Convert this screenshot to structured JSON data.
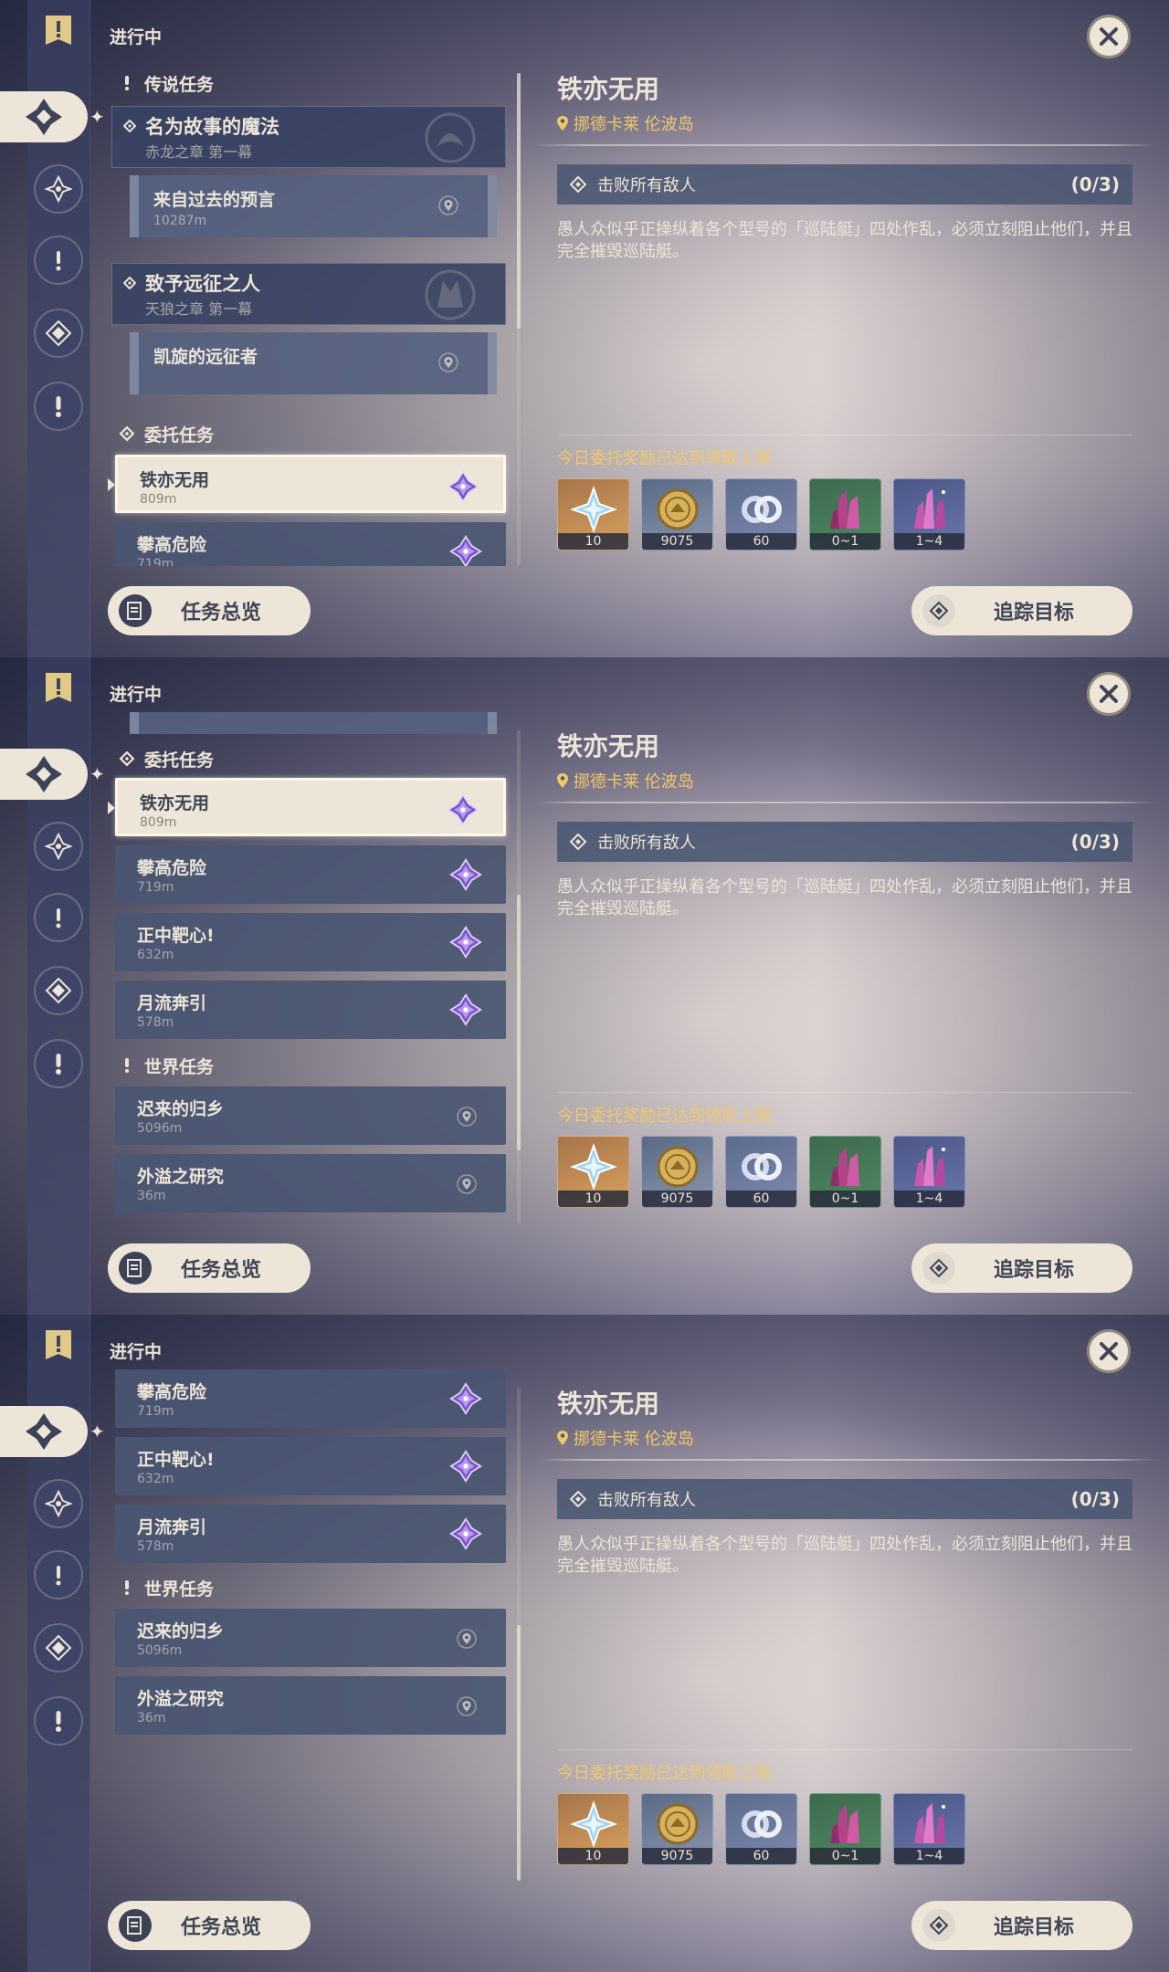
{
  "colors": {
    "accent_gold": "#f0c86a",
    "cream": "#ece5d8",
    "card_blue": "#4a5672",
    "badge_purple": "#8a5cd6"
  },
  "sidebar": {
    "icons": [
      "archon-quest-icon",
      "commission-icon",
      "story-quest-icon",
      "world-quest-icon",
      "event-quest-icon",
      "exclamation-quest-icon"
    ]
  },
  "header": {
    "in_progress": "进行中"
  },
  "sections": {
    "legend": "传说任务",
    "commission": "委托任务",
    "world": "世界任务"
  },
  "legend_quests": [
    {
      "title": "名为故事的魔法",
      "chapter": "赤龙之章 第一幕",
      "sub_name": "来自过去的预言",
      "sub_dist": "10287m"
    },
    {
      "title": "致予远征之人",
      "chapter": "天狼之章 第一幕",
      "sub_name": "凯旋的远征者",
      "sub_dist": ""
    }
  ],
  "commissions": [
    {
      "name": "铁亦无用",
      "dist": "809m"
    },
    {
      "name": "攀高危险",
      "dist": "719m"
    },
    {
      "name": "正中靶心!",
      "dist": "632m"
    },
    {
      "name": "月流奔引",
      "dist": "578m"
    }
  ],
  "world_quests": [
    {
      "name": "迟来的归乡",
      "dist": "5096m"
    },
    {
      "name": "外溢之研究",
      "dist": "36m"
    }
  ],
  "detail": {
    "title": "铁亦无用",
    "location": "挪德卡莱 伦波岛",
    "objective": "击败所有敌人",
    "objective_progress": "(0/3)",
    "description": "愚人众似乎正操纵着各个型号的「巡陆艇」四处作乱，必须立刻阻止他们，并且完全摧毁巡陆艇。",
    "reward_limit": "今日委托奖励已达到领取上限",
    "rewards": [
      {
        "icon": "primogem-icon",
        "count": "10"
      },
      {
        "icon": "mora-icon",
        "count": "9075"
      },
      {
        "icon": "companionship-exp-icon",
        "count": "60"
      },
      {
        "icon": "crystal-ore-icon",
        "count": "0~1"
      },
      {
        "icon": "crystal-chunk-icon",
        "count": "1~4"
      }
    ]
  },
  "buttons": {
    "overview": "任务总览",
    "track": "追踪目标"
  }
}
